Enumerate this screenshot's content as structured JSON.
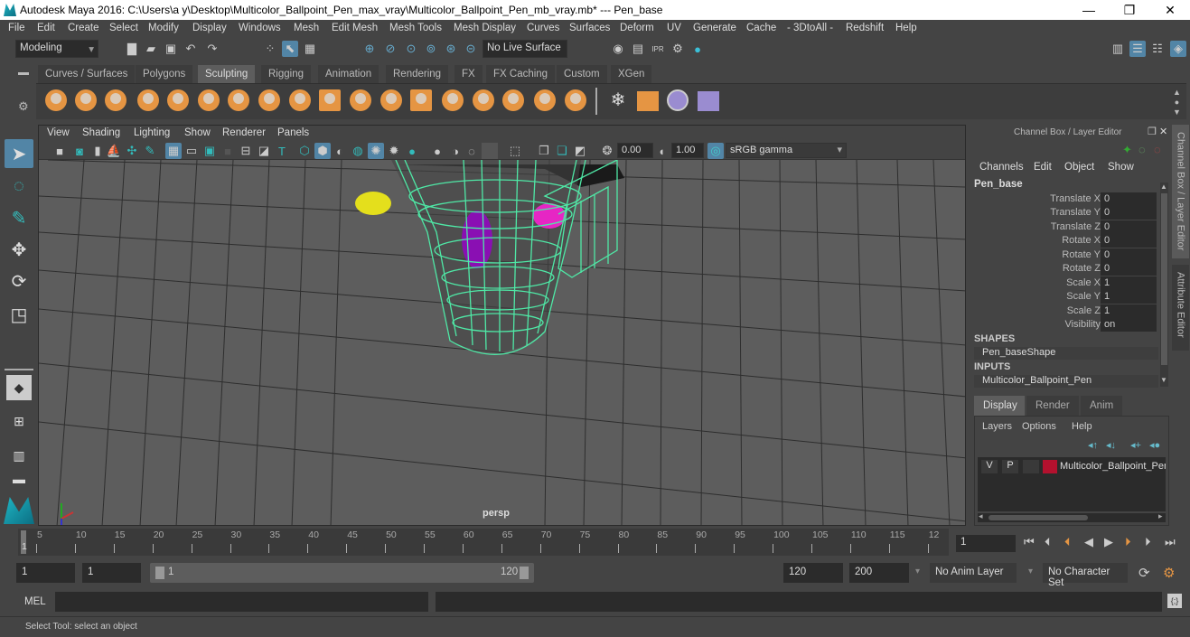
{
  "window": {
    "title": "Autodesk Maya 2016: C:\\Users\\a y\\Desktop\\Multicolor_Ballpoint_Pen_max_vray\\Multicolor_Ballpoint_Pen_mb_vray.mb*  ---  Pen_base",
    "minimize": "—",
    "maximize": "❐",
    "close": "✕"
  },
  "menubar": [
    "File",
    "Edit",
    "Create",
    "Select",
    "Modify",
    "Display",
    "Windows",
    "Mesh",
    "Edit Mesh",
    "Mesh Tools",
    "Mesh Display",
    "Curves",
    "Surfaces",
    "Deform",
    "UV",
    "Generate",
    "Cache",
    "- 3DtoAll -",
    "Redshift",
    "Help"
  ],
  "statusline": {
    "mode": "Modeling",
    "live_surface": "No Live Surface"
  },
  "shelf": {
    "tabs": [
      "Curves / Surfaces",
      "Polygons",
      "Sculpting",
      "Rigging",
      "Animation",
      "Rendering",
      "FX",
      "FX Caching",
      "Custom",
      "XGen"
    ],
    "active_tab": "Sculpting",
    "tool_icons": [
      "sculpt",
      "smooth",
      "relax",
      "grab",
      "pinch",
      "flatten",
      "foamy",
      "spray",
      "repeat",
      "imprint",
      "wax",
      "scrape",
      "fill",
      "knife",
      "smear",
      "bulge",
      "amplify",
      "freeze"
    ],
    "extra_icons": [
      "convert-to-frozen",
      "sculpt-window",
      "mesh-shape",
      "sculpt-layer"
    ]
  },
  "viewport": {
    "menu": [
      "View",
      "Shading",
      "Lighting",
      "Show",
      "Renderer",
      "Panels"
    ],
    "exposure": "0.00",
    "gamma": "1.00",
    "color_space": "sRGB gamma",
    "camera_label": "persp"
  },
  "channel_box": {
    "header": "Channel Box / Layer Editor",
    "menu": [
      "Channels",
      "Edit",
      "Object",
      "Show"
    ],
    "object_name": "Pen_base",
    "attributes": [
      {
        "label": "Translate X",
        "value": "0"
      },
      {
        "label": "Translate Y",
        "value": "0"
      },
      {
        "label": "Translate Z",
        "value": "0"
      },
      {
        "label": "Rotate X",
        "value": "0"
      },
      {
        "label": "Rotate Y",
        "value": "0"
      },
      {
        "label": "Rotate Z",
        "value": "0"
      },
      {
        "label": "Scale X",
        "value": "1"
      },
      {
        "label": "Scale Y",
        "value": "1"
      },
      {
        "label": "Scale Z",
        "value": "1"
      },
      {
        "label": "Visibility",
        "value": "on"
      }
    ],
    "shapes_header": "SHAPES",
    "shape_name": "Pen_baseShape",
    "inputs_header": "INPUTS",
    "input_name": "Multicolor_Ballpoint_Pen"
  },
  "layer_editor": {
    "tabs": [
      "Display",
      "Render",
      "Anim"
    ],
    "active_tab": "Display",
    "menu": [
      "Layers",
      "Options",
      "Help"
    ],
    "layers": [
      {
        "v": "V",
        "p": "P",
        "color": "#b3112e",
        "name": "Multicolor_Ballpoint_Pen"
      }
    ]
  },
  "side_tabs": [
    "Channel Box / Layer Editor",
    "Attribute Editor"
  ],
  "time_slider": {
    "ticks": [
      "5",
      "10",
      "15",
      "20",
      "25",
      "30",
      "35",
      "40",
      "45",
      "50",
      "55",
      "60",
      "65",
      "70",
      "75",
      "80",
      "85",
      "90",
      "95",
      "100",
      "105",
      "110",
      "115",
      "12"
    ],
    "current_frame_marker": "1",
    "current_frame": "1"
  },
  "range_slider": {
    "start": "1",
    "playback_start": "1",
    "range_start": "1",
    "range_end": "120",
    "playback_end": "120",
    "end": "200",
    "anim_layer": "No Anim Layer",
    "character_set": "No Character Set"
  },
  "command_line": {
    "label": "MEL"
  },
  "help_line": "Select Tool: select an object",
  "colors": {
    "accent": "#5285a6",
    "wireframe": "#4fe8a6",
    "shelf_orange": "#e59543",
    "layer_color": "#b3112e"
  }
}
